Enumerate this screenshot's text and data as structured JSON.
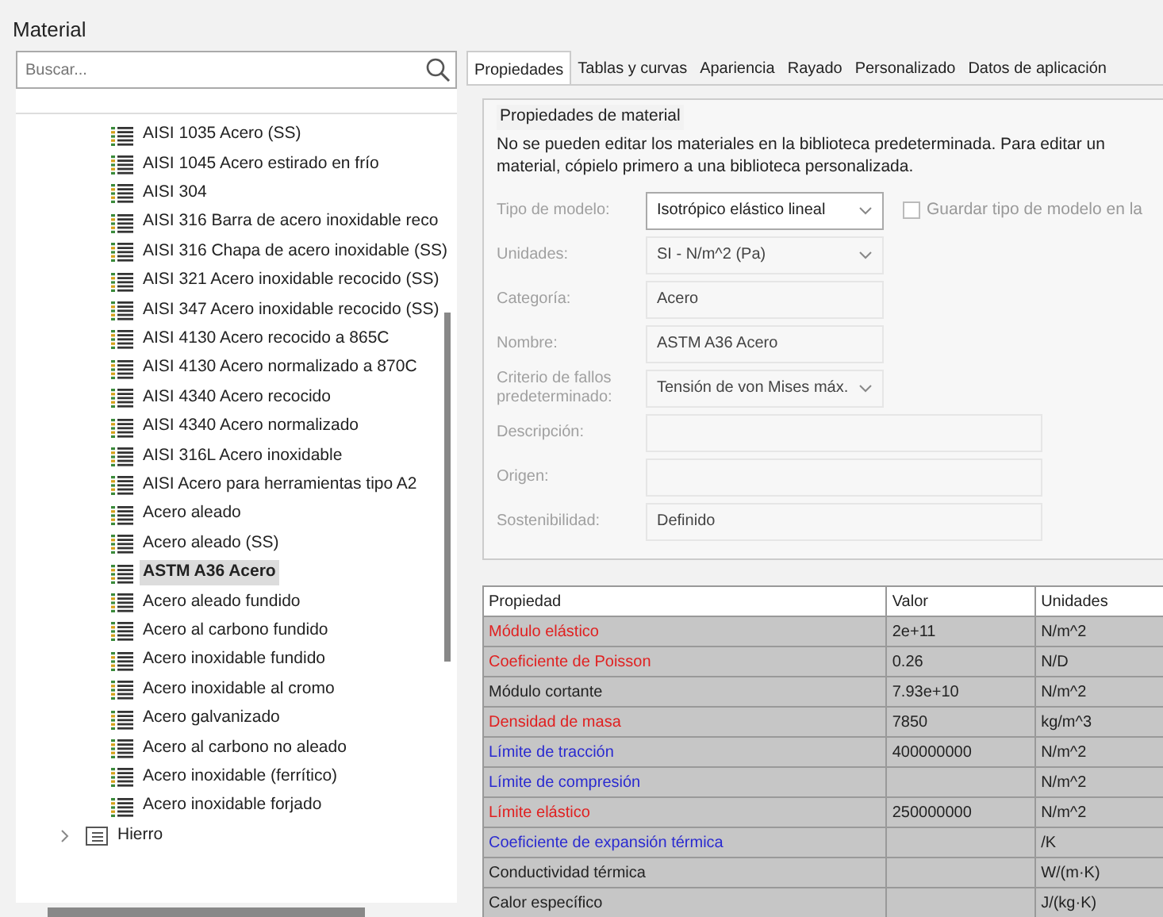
{
  "window": {
    "title": "Material"
  },
  "search": {
    "placeholder": "Buscar..."
  },
  "tree": [
    {
      "label": "AISI 1035 Acero (SS)",
      "kind": "material",
      "selected": false
    },
    {
      "label": "AISI 1045 Acero estirado en frío",
      "kind": "material",
      "selected": false
    },
    {
      "label": "AISI 304",
      "kind": "material",
      "selected": false
    },
    {
      "label": "AISI 316 Barra de acero inoxidable reco",
      "kind": "material",
      "selected": false
    },
    {
      "label": "AISI 316 Chapa de acero inoxidable (SS)",
      "kind": "material",
      "selected": false
    },
    {
      "label": "AISI 321 Acero inoxidable recocido (SS)",
      "kind": "material",
      "selected": false
    },
    {
      "label": "AISI 347 Acero inoxidable recocido (SS)",
      "kind": "material",
      "selected": false
    },
    {
      "label": "AISI 4130 Acero recocido a 865C",
      "kind": "material",
      "selected": false
    },
    {
      "label": "AISI 4130 Acero normalizado a 870C",
      "kind": "material",
      "selected": false
    },
    {
      "label": "AISI 4340 Acero recocido",
      "kind": "material",
      "selected": false
    },
    {
      "label": "AISI 4340 Acero normalizado",
      "kind": "material",
      "selected": false
    },
    {
      "label": "AISI 316L Acero inoxidable",
      "kind": "material",
      "selected": false
    },
    {
      "label": "AISI Acero para herramientas tipo A2",
      "kind": "material",
      "selected": false
    },
    {
      "label": "Acero aleado",
      "kind": "material",
      "selected": false
    },
    {
      "label": "Acero aleado (SS)",
      "kind": "material",
      "selected": false
    },
    {
      "label": "ASTM A36 Acero",
      "kind": "material",
      "selected": true
    },
    {
      "label": "Acero aleado fundido",
      "kind": "material",
      "selected": false
    },
    {
      "label": "Acero al carbono fundido",
      "kind": "material",
      "selected": false
    },
    {
      "label": "Acero inoxidable fundido",
      "kind": "material",
      "selected": false
    },
    {
      "label": "Acero inoxidable al cromo",
      "kind": "material",
      "selected": false
    },
    {
      "label": "Acero galvanizado",
      "kind": "material",
      "selected": false
    },
    {
      "label": "Acero al carbono no aleado",
      "kind": "material",
      "selected": false
    },
    {
      "label": "Acero inoxidable (ferrítico)",
      "kind": "material",
      "selected": false
    },
    {
      "label": "Acero inoxidable forjado",
      "kind": "material",
      "selected": false
    },
    {
      "label": "Hierro",
      "kind": "folder",
      "selected": false,
      "expanded": false
    }
  ],
  "tabs": [
    {
      "label": "Propiedades",
      "selected": true
    },
    {
      "label": "Tablas y curvas",
      "selected": false
    },
    {
      "label": "Apariencia",
      "selected": false
    },
    {
      "label": "Rayado",
      "selected": false
    },
    {
      "label": "Personalizado",
      "selected": false
    },
    {
      "label": "Datos de aplicación",
      "selected": false
    }
  ],
  "group": {
    "title": "Propiedades de material",
    "notice": "No se pueden editar los materiales en la biblioteca predeterminada. Para editar un material, cópielo primero a una biblioteca personalizada."
  },
  "fields": [
    {
      "label": "Tipo de modelo:",
      "value": "Isotrópico elástico lineal",
      "kind": "dropdown",
      "focused": true,
      "checkbox": {
        "label": "Guardar tipo de modelo en la",
        "checked": false
      }
    },
    {
      "label": "Unidades:",
      "value": "SI - N/m^2 (Pa)",
      "kind": "dropdown",
      "focused": false
    },
    {
      "label": "Categoría:",
      "value": "Acero",
      "kind": "text"
    },
    {
      "label": "Nombre:",
      "value": "ASTM A36 Acero",
      "kind": "text"
    },
    {
      "label": "Criterio de fallos predeterminado:",
      "value": "Tensión de von Mises máx.",
      "kind": "dropdown",
      "focused": false
    },
    {
      "label": "Descripción:",
      "kind": "wide"
    },
    {
      "label": "Origen:",
      "kind": "wide"
    },
    {
      "label": "Sostenibilidad:",
      "value": "Definido",
      "kind": "wide"
    }
  ],
  "table": {
    "columns": [
      "Propiedad",
      "Valor",
      "Unidades"
    ],
    "rows": [
      {
        "property": "Módulo elástico",
        "value": "2e+11",
        "units": "N/m^2",
        "color": "#e02020"
      },
      {
        "property": "Coeficiente de Poisson",
        "value": "0.26",
        "units": "N/D",
        "color": "#e02020"
      },
      {
        "property": "Módulo cortante",
        "value": "7.93e+10",
        "units": "N/m^2",
        "color": "#222222"
      },
      {
        "property": "Densidad de masa",
        "value": "7850",
        "units": "kg/m^3",
        "color": "#e02020"
      },
      {
        "property": "Límite de tracción",
        "value": "400000000",
        "units": "N/m^2",
        "color": "#2a2ad0"
      },
      {
        "property": "Límite de compresión",
        "units": "N/m^2",
        "color": "#2a2ad0"
      },
      {
        "property": "Límite elástico",
        "value": "250000000",
        "units": "N/m^2",
        "color": "#e02020"
      },
      {
        "property": "Coeficiente de expansión térmica",
        "units": "/K",
        "color": "#2a2ad0"
      },
      {
        "property": "Conductividad térmica",
        "units": "W/(m·K)",
        "color": "#222222"
      },
      {
        "property": "Calor específico",
        "units": "J/(kg·K)",
        "color": "#222222"
      }
    ]
  }
}
